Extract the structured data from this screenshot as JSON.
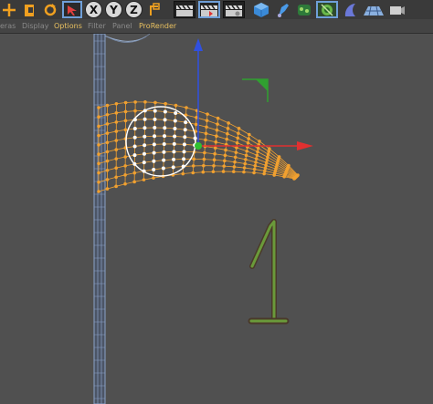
{
  "toolbar": {
    "axis_x": "X",
    "axis_y": "Y",
    "axis_z": "Z",
    "icons": [
      "move-icon",
      "scale-icon",
      "rotate-icon",
      "cursor-icon",
      "lock-x-icon",
      "lock-y-icon",
      "lock-z-icon",
      "coordinate-system-icon",
      "render-view-icon",
      "render-to-picture-viewer-icon",
      "edit-render-settings-icon",
      "cube-icon",
      "pen-icon",
      "subdivision-icon",
      "sculpt-icon",
      "array-icon",
      "deformer-icon",
      "floor-icon",
      "camera-icon"
    ]
  },
  "menu": {
    "cameras": "eras",
    "display": "Display",
    "options": "Options",
    "filter": "Filter",
    "panel": "Panel",
    "prorender": "ProRender"
  },
  "viewport": {
    "background": "#505050",
    "annotation_text": "1",
    "colors": {
      "mesh_points": "#f0a030",
      "selected_points": "#ffffff",
      "wire": "#9ab0d0",
      "axis_x": "#e03030",
      "axis_y": "#3050e0",
      "axis_z": "#30a030",
      "drawing": "#6a9a3a"
    }
  }
}
